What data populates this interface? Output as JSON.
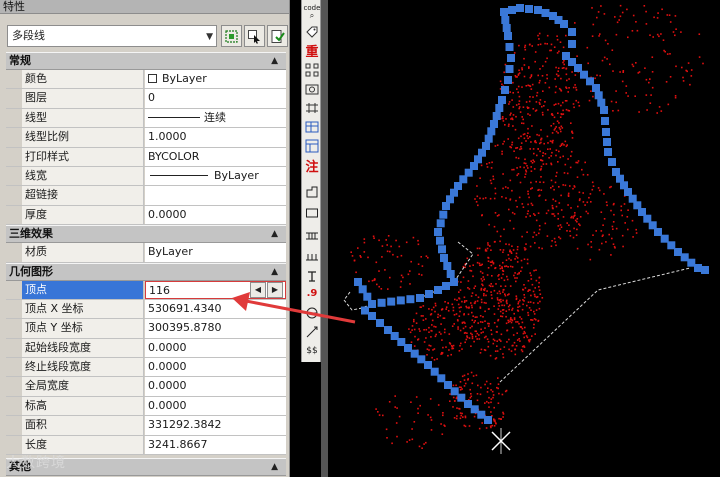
{
  "panel": {
    "title": "特性",
    "object_type": "多段线",
    "sections": {
      "general": "常规",
      "three_d": "三维效果",
      "geometry": "几何图形",
      "other": "其他"
    },
    "general_rows": [
      {
        "label": "颜色",
        "value": "ByLayer"
      },
      {
        "label": "图层",
        "value": "0"
      },
      {
        "label": "线型",
        "value": "连续"
      },
      {
        "label": "线型比例",
        "value": "1.0000"
      },
      {
        "label": "打印样式",
        "value": "BYCOLOR"
      },
      {
        "label": "线宽",
        "value": "ByLayer"
      },
      {
        "label": "超链接",
        "value": ""
      },
      {
        "label": "厚度",
        "value": "0.0000"
      }
    ],
    "three_d_rows": [
      {
        "label": "材质",
        "value": "ByLayer"
      }
    ],
    "geometry_rows": [
      {
        "label": "顶点",
        "value": "116"
      },
      {
        "label": "顶点 X 坐标",
        "value": "530691.4340"
      },
      {
        "label": "顶点 Y 坐标",
        "value": "300395.8780"
      },
      {
        "label": "起始线段宽度",
        "value": "0.0000"
      },
      {
        "label": "终止线段宽度",
        "value": "0.0000"
      },
      {
        "label": "全局宽度",
        "value": "0.0000"
      },
      {
        "label": "标高",
        "value": "0.0000"
      },
      {
        "label": "面积",
        "value": "331292.3842"
      },
      {
        "label": "长度",
        "value": "3241.8667"
      }
    ],
    "watermark": "大数跨境"
  },
  "toolbar": {
    "items": [
      "code",
      "重",
      "注",
      ".9",
      "$$"
    ]
  },
  "colors": {
    "polyline": "#3a78d8",
    "points": "#e01010",
    "highlight": "#3875d7",
    "arrow": "#e03a3a"
  },
  "icons": [
    "dropdown-arrow-icon",
    "quick-select-icon",
    "select-objects-icon",
    "pickadd-icon",
    "collapse-caret-icon",
    "stepper-left-icon",
    "stepper-right-icon"
  ]
}
